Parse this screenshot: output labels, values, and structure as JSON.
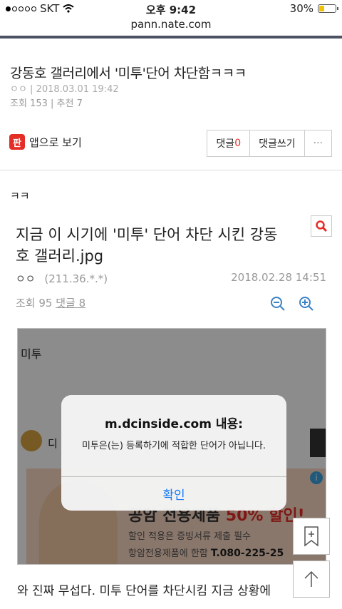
{
  "status": {
    "carrier": "SKT",
    "time": "오후 9:42",
    "battery": "30%",
    "battery_level": 0.3
  },
  "browser": {
    "url": "pann.nate.com"
  },
  "post": {
    "title": "강동호 갤러리에서 '미투'단어 차단함ㅋㅋㅋ",
    "author": "ㅇㅇ",
    "date": "2018.03.01 19:42",
    "views_label": "조회 153",
    "recommend_label": "추천 7"
  },
  "actions": {
    "app_view": "앱으로 보기",
    "app_icon_text": "판",
    "comment_label": "댓글",
    "comment_count": "0",
    "write_comment": "댓글쓰기",
    "more": "···"
  },
  "body": {
    "intro": "ㅋㅋ",
    "bottom_text": "와 진짜 무섭다. 미투 단어를 차단시킴 지금 상황에"
  },
  "screenshot": {
    "title": "지금 이 시기에 '미투' 단어 차단 시킨 강동호 갤러리.jpg",
    "author": "ㅇㅇ",
    "ip": "(211.36.*.*)",
    "date": "2018.02.28 14:51",
    "views": "조회 95",
    "comments": "댓글 8",
    "image_word": "미투",
    "dc_label": "디",
    "ad_big_prefix": "공암 전용제품",
    "ad_big_pct": "50% 할인!",
    "ad_line1": "할인 적용은 증빙서류 제출 필수",
    "ad_line2_prefix": "항암전용제품에 한함",
    "ad_phone": "T.080-225-25"
  },
  "alert": {
    "title": "m.dcinside.com 내용:",
    "message": "미투은(는) 등록하기에 적합한 단어가 아닙니다.",
    "ok": "확인"
  }
}
